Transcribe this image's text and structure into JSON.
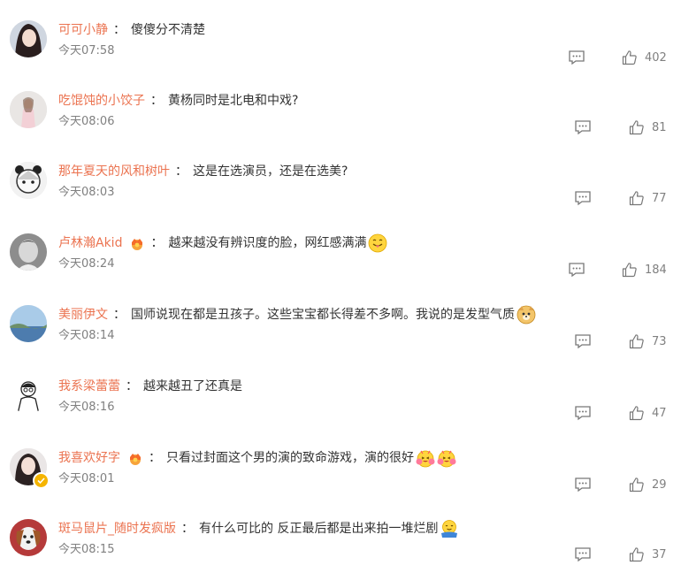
{
  "comments": [
    {
      "user": "可可小静",
      "text": "傻傻分不清楚",
      "time": "今天07:58",
      "likes": "402",
      "crown": false,
      "emoji": []
    },
    {
      "user": "吃馄饨的小饺子",
      "text": "黄杨同时是北电和中戏?",
      "time": "今天08:06",
      "likes": "81",
      "crown": false,
      "emoji": []
    },
    {
      "user": "那年夏天的风和树叶",
      "text": "这是在选演员，还是在选美?",
      "time": "今天08:03",
      "likes": "77",
      "crown": false,
      "emoji": []
    },
    {
      "user": "卢林瀚Akid",
      "text": "越来越没有辨识度的脸，网红感满满",
      "time": "今天08:24",
      "likes": "184",
      "crown": true,
      "emoji": [
        "tongue-emoji"
      ]
    },
    {
      "user": "美丽伊文",
      "text": "国师说现在都是丑孩子。这些宝宝都长得差不多啊。我说的是发型气质",
      "time": "今天08:14",
      "likes": "73",
      "crown": false,
      "emoji": [
        "doge-emoji"
      ]
    },
    {
      "user": "我系梁蕾蕾",
      "text": "越来越丑了还真是",
      "time": "今天08:16",
      "likes": "47",
      "crown": false,
      "emoji": []
    },
    {
      "user": "我喜欢好字",
      "text": "只看过封面这个男的演的致命游戏，演的很好",
      "time": "今天08:01",
      "likes": "29",
      "crown": true,
      "emoji": [
        "cheer-emoji",
        "cheer-emoji"
      ]
    },
    {
      "user": "斑马鼠片_随时发疯版",
      "text": "有什么可比的 反正最后都是出来拍一堆烂剧",
      "time": "今天08:15",
      "likes": "37",
      "crown": false,
      "emoji": [
        "hug-emoji"
      ]
    }
  ],
  "colors": {
    "username": "#eb7350",
    "text": "#333333",
    "meta": "#808080"
  }
}
